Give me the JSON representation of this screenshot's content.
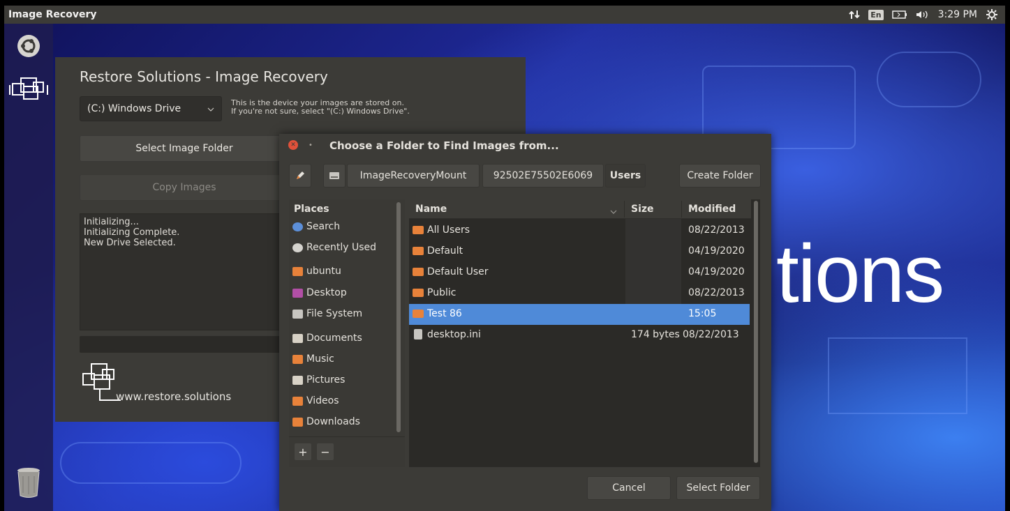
{
  "topbar": {
    "app_title": "Image Recovery",
    "keyboard": "En",
    "clock": "3:29 PM"
  },
  "desktop": {
    "background_text": "tions"
  },
  "main_window": {
    "title": "Restore Solutions - Image Recovery",
    "drive_select": {
      "value": "(C:) Windows Drive"
    },
    "drive_hint_line1": "This is the device your images are stored on.",
    "drive_hint_line2": "If you're not sure, select \"(C:) Windows Drive\".",
    "select_folder_label": "Select Image Folder",
    "copy_images_label": "Copy Images",
    "log": [
      "Initializing...",
      "Initializing Complete.",
      "New Drive Selected."
    ],
    "website": "www.restore.solutions"
  },
  "dialog": {
    "title": "Choose a Folder to Find Images from...",
    "path": [
      "ImageRecoveryMount",
      "92502E75502E6069",
      "Users"
    ],
    "create_folder_label": "Create Folder",
    "places_header": "Places",
    "places": [
      {
        "label": "Search",
        "icon": "search-icon"
      },
      {
        "label": "Recently Used",
        "icon": "recent-icon"
      },
      {
        "label": "ubuntu",
        "icon": "home-folder-icon"
      },
      {
        "label": "Desktop",
        "icon": "desktop-icon"
      },
      {
        "label": "File System",
        "icon": "drive-icon"
      },
      {
        "label": "Documents",
        "icon": "documents-icon"
      },
      {
        "label": "Music",
        "icon": "music-icon"
      },
      {
        "label": "Pictures",
        "icon": "pictures-icon"
      },
      {
        "label": "Videos",
        "icon": "videos-icon"
      },
      {
        "label": "Downloads",
        "icon": "downloads-icon"
      }
    ],
    "columns": {
      "name": "Name",
      "size": "Size",
      "modified": "Modified"
    },
    "files": [
      {
        "name": "All Users",
        "size": "",
        "modified": "08/22/2013",
        "type": "folder"
      },
      {
        "name": "Default",
        "size": "",
        "modified": "04/19/2020",
        "type": "folder"
      },
      {
        "name": "Default User",
        "size": "",
        "modified": "04/19/2020",
        "type": "folder"
      },
      {
        "name": "Public",
        "size": "",
        "modified": "08/22/2013",
        "type": "folder"
      },
      {
        "name": "Test 86",
        "size": "",
        "modified": "15:05",
        "type": "folder",
        "selected": true
      },
      {
        "name": "desktop.ini",
        "size": "174 bytes",
        "modified": "08/22/2013",
        "type": "file"
      }
    ],
    "cancel_label": "Cancel",
    "select_label": "Select Folder"
  },
  "colors": {
    "panel": "#3c3b37",
    "selection": "#4f8ad8",
    "folder": "#e8823a",
    "close": "#e0513a"
  }
}
